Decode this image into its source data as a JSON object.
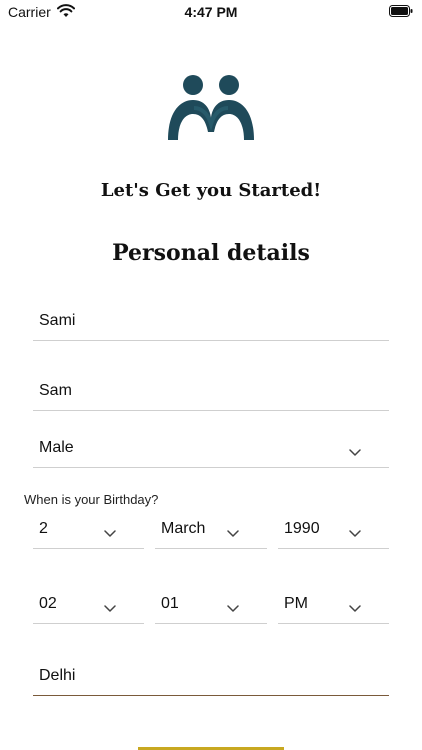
{
  "status_bar": {
    "carrier": "Carrier",
    "time": "4:47 PM"
  },
  "header": {
    "headline": "Let's Get you Started!",
    "section_title": "Personal details"
  },
  "form": {
    "first_name": "Sami",
    "last_name": "Sam",
    "gender": "Male",
    "birthday_label": "When is your Birthday?",
    "birth_day": "2",
    "birth_month": "March",
    "birth_year": "1990",
    "time_hour": "02",
    "time_minute": "01",
    "time_period": "PM",
    "city": "Delhi"
  },
  "colors": {
    "logo": "#1f4a5a",
    "active_underline": "#7a5a3a",
    "bottom_accent": "#c8a820",
    "divider": "#cfcfcf"
  }
}
